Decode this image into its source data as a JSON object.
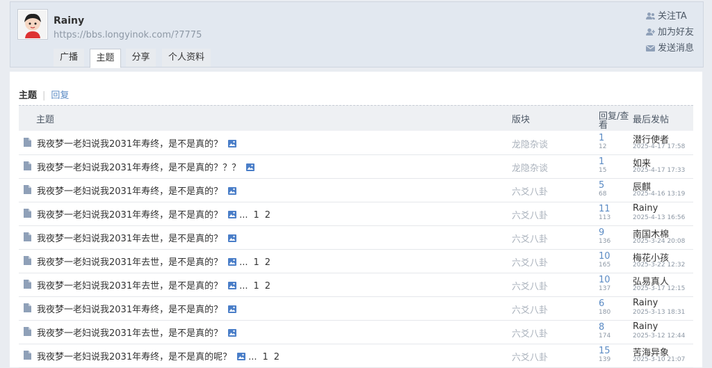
{
  "profile": {
    "name": "Rainy",
    "url": "https://bbs.longyinok.com/?7775",
    "tabs": [
      "广播",
      "主题",
      "分享",
      "个人资料"
    ],
    "active_tab": "主题",
    "actions": [
      {
        "label": "关注TA",
        "icon": "follow-icon"
      },
      {
        "label": "加为好友",
        "icon": "add-friend-icon"
      },
      {
        "label": "发送消息",
        "icon": "message-icon"
      }
    ]
  },
  "subtabs": {
    "current": "主题",
    "other": "回复"
  },
  "table": {
    "headers": {
      "title": "主题",
      "forum": "版块",
      "reply_view": "回复/查看",
      "last": "最后发帖"
    },
    "rows": [
      {
        "title": "我夜梦一老妇说我2031年寿终，是不是真的？",
        "has_image": true,
        "pages": [],
        "forum": "龙隐杂谈",
        "replies": "1",
        "views": "12",
        "last_user": "潜行使者",
        "last_time": "2025-4-17 17:58"
      },
      {
        "title": "我夜梦一老妇说我2031年寿终，是不是真的？？？",
        "has_image": true,
        "pages": [],
        "forum": "龙隐杂谈",
        "replies": "1",
        "views": "15",
        "last_user": "如来",
        "last_time": "2025-4-17 17:33"
      },
      {
        "title": "我夜梦一老妇说我2031年寿终，是不是真的？",
        "has_image": true,
        "pages": [],
        "forum": "六爻八卦",
        "replies": "5",
        "views": "68",
        "last_user": "辰麒",
        "last_time": "2025-4-16 13:19"
      },
      {
        "title": "我夜梦一老妇说我2031年寿终，是不是真的？",
        "has_image": true,
        "pages": [
          "1",
          "2"
        ],
        "forum": "六爻八卦",
        "replies": "11",
        "views": "113",
        "last_user": "Rainy",
        "last_time": "2025-4-13 16:56"
      },
      {
        "title": "我夜梦一老妇说我2031年去世，是不是真的？",
        "has_image": true,
        "pages": [],
        "forum": "六爻八卦",
        "replies": "9",
        "views": "136",
        "last_user": "南国木棉",
        "last_time": "2025-3-24 20:08"
      },
      {
        "title": "我夜梦一老妇说我2031年去世，是不是真的？",
        "has_image": true,
        "pages": [
          "1",
          "2"
        ],
        "forum": "六爻八卦",
        "replies": "10",
        "views": "165",
        "last_user": "梅花小孩",
        "last_time": "2025-3-22 12:32"
      },
      {
        "title": "我夜梦一老妇说我2031年去世，是不是真的？",
        "has_image": true,
        "pages": [
          "1",
          "2"
        ],
        "forum": "六爻八卦",
        "replies": "10",
        "views": "137",
        "last_user": "弘易真人",
        "last_time": "2025-3-17 12:15"
      },
      {
        "title": "我夜梦一老妇说我2031年寿终，是不是真的？",
        "has_image": true,
        "pages": [],
        "forum": "六爻八卦",
        "replies": "6",
        "views": "180",
        "last_user": "Rainy",
        "last_time": "2025-3-13 18:31"
      },
      {
        "title": "我夜梦一老妇说我2031年去世，是不是真的？",
        "has_image": true,
        "pages": [],
        "forum": "六爻八卦",
        "replies": "8",
        "views": "174",
        "last_user": "Rainy",
        "last_time": "2025-3-12 12:44"
      },
      {
        "title": "我夜梦一老妇说我2031年寿终，是不是真的呢？",
        "has_image": true,
        "pages": [
          "1",
          "2"
        ],
        "forum": "六爻八卦",
        "replies": "15",
        "views": "139",
        "last_user": "苦海异象",
        "last_time": "2025-3-10 21:07"
      }
    ]
  },
  "colors": {
    "link": "#5b8bc4",
    "header_bg": "#e2e8f0",
    "muted": "#aab2bc"
  }
}
